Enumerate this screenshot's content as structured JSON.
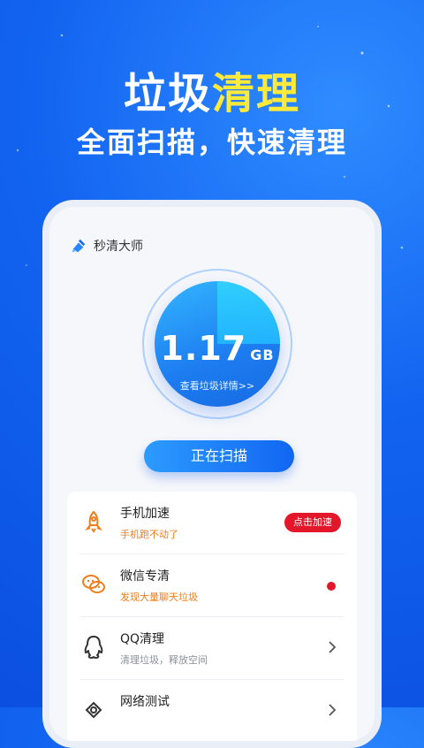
{
  "banner": {
    "headline_part1": "垃圾",
    "headline_part2": "清理",
    "subline": "全面扫描，快速清理"
  },
  "app": {
    "title": "秒清大师",
    "logo_icon": "broom-icon"
  },
  "scan": {
    "size_value": "1.17",
    "size_unit": "GB",
    "details_link": "查看垃圾详情>>",
    "button_label": "正在扫描"
  },
  "features": [
    {
      "title": "手机加速",
      "subtitle": "手机跑不动了",
      "icon": "rocket-icon",
      "action_label": "点击加速"
    },
    {
      "title": "微信专清",
      "subtitle": "发现大量聊天垃圾",
      "icon": "wechat-icon"
    },
    {
      "title": "QQ清理",
      "subtitle": "清理垃圾，释放空间",
      "icon": "qq-icon"
    },
    {
      "title": "网络测试",
      "icon": "network-icon"
    }
  ],
  "colors": {
    "accent_yellow": "#ffea3a",
    "primary_blue": "#1266f2",
    "alert_red": "#e4172a",
    "orange_text": "#f07d1a"
  }
}
